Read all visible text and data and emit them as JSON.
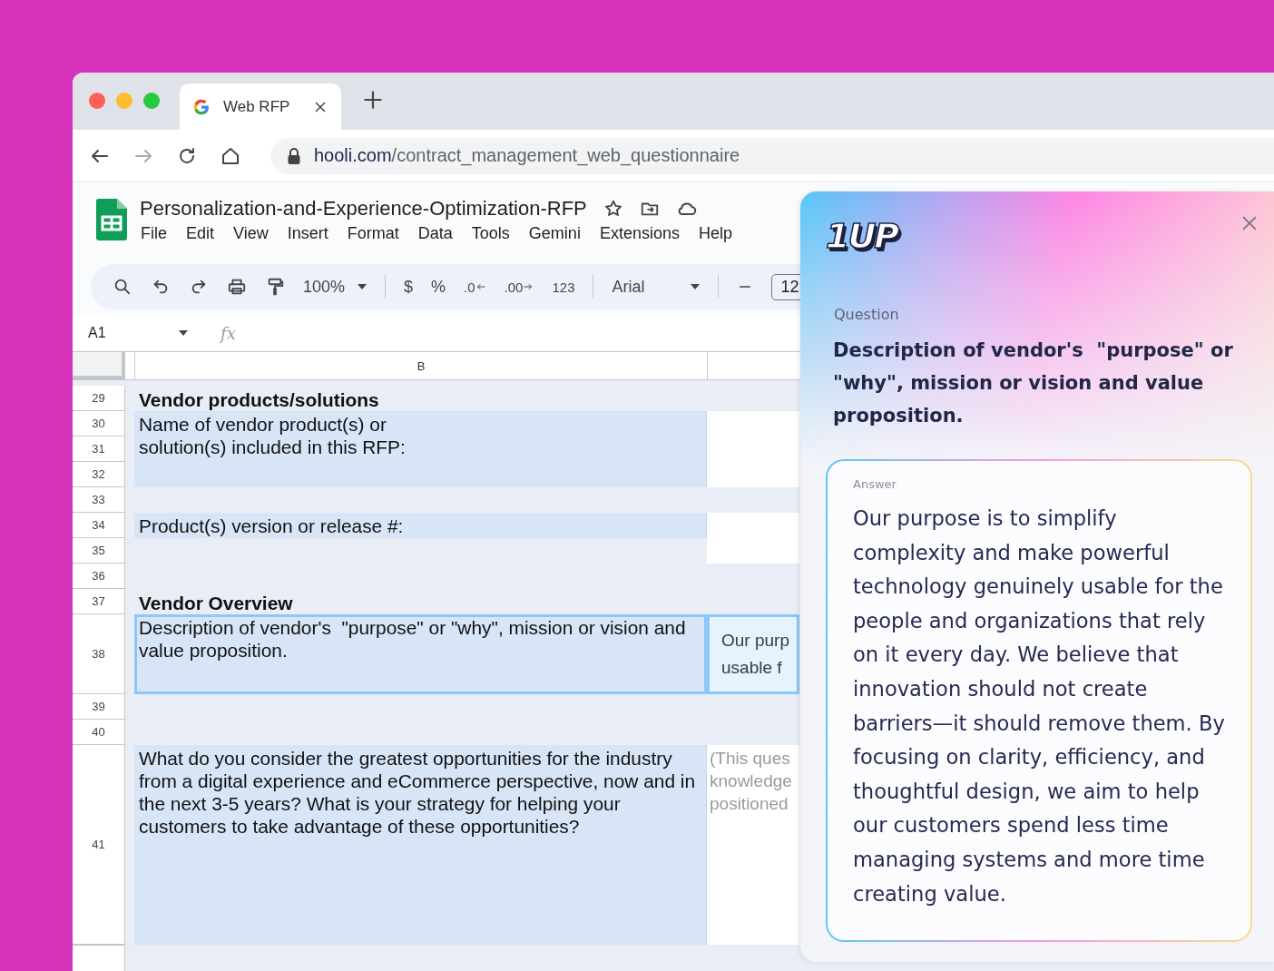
{
  "browser": {
    "tabs": [
      {
        "title": "Web RFP",
        "selected": true
      }
    ],
    "nav": {
      "back": {
        "disabled": false
      },
      "forward": {
        "disabled": true
      }
    },
    "url": {
      "host": "hooli.com",
      "path": "/contract_management_web_questionnaire"
    }
  },
  "sheet": {
    "title": "Personalization-and-Experience-Optimization-RFP",
    "menu": [
      "File",
      "Edit",
      "View",
      "Insert",
      "Format",
      "Data",
      "Tools",
      "Gemini",
      "Extensions",
      "Help"
    ],
    "toolbar": {
      "zoom": "100%",
      "currency": "$",
      "percent": "%",
      "decrease_decimals": ".0",
      "increase_decimals": ".00",
      "number_format": "123",
      "font": "Arial",
      "font_size": "12"
    },
    "name_box": "A1",
    "formula_icon": "fx",
    "columns": [
      "B"
    ],
    "rows": [
      {
        "kind": "heading",
        "numbers": [
          "29"
        ],
        "text": "Vendor products/solutions"
      },
      {
        "kind": "question",
        "numbers": [
          "30",
          "31",
          "32"
        ],
        "text": "Name of vendor product(s) or\nsolution(s) included in this RFP:",
        "selected": false
      },
      {
        "kind": "blank",
        "numbers": [
          "33"
        ]
      },
      {
        "kind": "question",
        "numbers": [
          "34",
          "35"
        ],
        "text": "Product(s) version or release #:",
        "selected": false
      },
      {
        "kind": "blank",
        "numbers": [
          "36"
        ]
      },
      {
        "kind": "heading",
        "numbers": [
          "37"
        ],
        "text": "Vendor Overview"
      },
      {
        "kind": "question",
        "numbers": [
          "38"
        ],
        "text": "Description of vendor's  \"purpose\" or \"why\", mission or vision and value proposition.",
        "answer": "Our purp\nusable f",
        "hint": false,
        "selected": true
      },
      {
        "kind": "blank",
        "numbers": [
          "39",
          "40"
        ]
      },
      {
        "kind": "question",
        "numbers": [
          "41"
        ],
        "text": "What do you consider the greatest opportunities for the industry from a digital experience and eCommerce perspective, now and in the next 3-5 years? What is your strategy for helping your customers to take advantage of these opportunities?",
        "answer": "(This ques\nknowledge\npositioned",
        "hint": true,
        "selected": false
      }
    ]
  },
  "panel": {
    "logo": "1UP",
    "question_label": "Question",
    "question": "Description of vendor's  \"purpose\" or \"why\", mission or vision and value proposition.",
    "answer_label": "Answer",
    "answer": "Our purpose is to simplify complexity and make powerful technology genuinely usable for the people and organizations that rely on it every day. We believe that innovation should not create barriers—it should remove them. By focusing on clarity, efficiency, and thoughtful design, we aim to help our customers spend less time managing systems and more time creating value."
  }
}
